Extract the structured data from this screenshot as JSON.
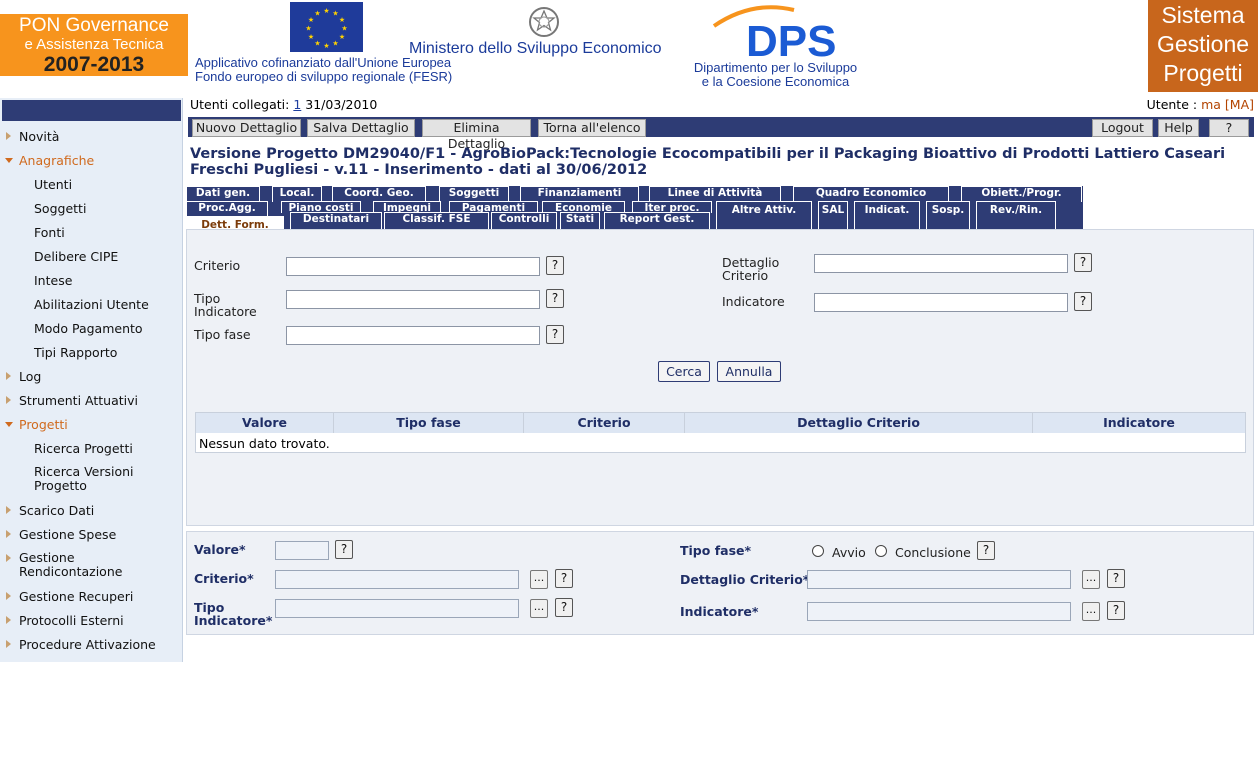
{
  "header": {
    "left_logo": {
      "line1": "PON Governance",
      "line2": "e Assistenza Tecnica",
      "line3": "2007-2013"
    },
    "eu_text": {
      "line1": "Applicativo cofinanziato dall'Unione Europea",
      "line2": "Fondo europeo di sviluppo regionale (FESR)"
    },
    "ministry": "Ministero dello Sviluppo Economico",
    "dps_logo": "DPS",
    "dps_text": {
      "line1": "Dipartimento per lo Sviluppo",
      "line2": "e la Coesione Economica"
    },
    "right_logo": {
      "line1": "Sistema",
      "line2": "Gestione",
      "line3": "Progetti"
    },
    "colors": {
      "brand_orange": "#f7941d",
      "navy": "#2e3c75",
      "brown": "#c8661c",
      "link_blue": "#1b3b9a"
    }
  },
  "status": {
    "users_label": "Utenti collegati:",
    "users_count": "1",
    "date": "31/03/2010",
    "user_label": "Utente :",
    "user_name": "ma",
    "user_code": "[MA]"
  },
  "toolbar": {
    "new": "Nuovo Dettaglio",
    "save": "Salva Dettaglio",
    "delete": "Elimina Dettaglio",
    "back": "Torna all'elenco",
    "logout": "Logout",
    "help": "Help",
    "question": "?"
  },
  "project": {
    "line1": "Versione Progetto   DM29040/F1 - AgroBioPack:Tecnologie Ecocompatibili per il Packaging Bioattivo di Prodotti Lattiero Caseari",
    "line2": "Freschi Pugliesi -  v.11 -  Inserimento -  dati al 30/06/2012"
  },
  "sidebar": {
    "items": [
      {
        "label": "Novità"
      },
      {
        "label": "Anagrafiche"
      },
      {
        "label": "Utenti"
      },
      {
        "label": "Soggetti"
      },
      {
        "label": "Fonti"
      },
      {
        "label": "Delibere CIPE"
      },
      {
        "label": "Intese"
      },
      {
        "label": "Abilitazioni Utente"
      },
      {
        "label": "Modo Pagamento"
      },
      {
        "label": "Tipi Rapporto"
      },
      {
        "label": "Log"
      },
      {
        "label": "Strumenti Attuativi"
      },
      {
        "label": "Progetti"
      },
      {
        "label": "Ricerca Progetti"
      },
      {
        "label": "Ricerca Versioni Progetto"
      },
      {
        "label": "Scarico Dati"
      },
      {
        "label": "Gestione Spese"
      },
      {
        "label": "Gestione Rendicontazione"
      },
      {
        "label": "Gestione Recuperi"
      },
      {
        "label": "Protocolli Esterni"
      },
      {
        "label": "Procedure Attivazione"
      }
    ]
  },
  "tabs": {
    "row1": [
      "Dati gen.",
      "Local.",
      "Coord. Geo.",
      "Soggetti",
      "Finanziamenti",
      "Linee di Attività",
      "Quadro Economico",
      "Obiett./Progr."
    ],
    "row2": [
      "Proc.Agg.",
      "Piano costi",
      "Impegni",
      "Pagamenti",
      "Economie",
      "Iter proc.",
      "Altre Attiv.",
      "SAL",
      "Indicat.",
      "Sosp.",
      "Rev./Rin."
    ],
    "row3": [
      "Dett. Form.",
      "Destinatari",
      "Classif. FSE",
      "Controlli",
      "Stati",
      "Report Gest."
    ]
  },
  "search": {
    "criterio": "Criterio",
    "tipo_indicatore": "Tipo Indicatore",
    "tipo_fase": "Tipo fase",
    "dettaglio_criterio": "Dettaglio Criterio",
    "indicatore": "Indicatore",
    "help": "?",
    "cerca": "Cerca",
    "annulla": "Annulla"
  },
  "results": {
    "columns": [
      "Valore",
      "Tipo fase",
      "Criterio",
      "Dettaglio Criterio",
      "Indicatore"
    ],
    "empty": "Nessun dato trovato."
  },
  "detail": {
    "valore": "Valore*",
    "criterio": "Criterio*",
    "tipo_indicatore": "Tipo Indicatore*",
    "tipo_fase": "Tipo fase*",
    "avvio": "Avvio",
    "conclusione": "Conclusione",
    "dettaglio_criterio": "Dettaglio Criterio*",
    "indicatore": "Indicatore*",
    "help": "?",
    "browse": "..."
  }
}
